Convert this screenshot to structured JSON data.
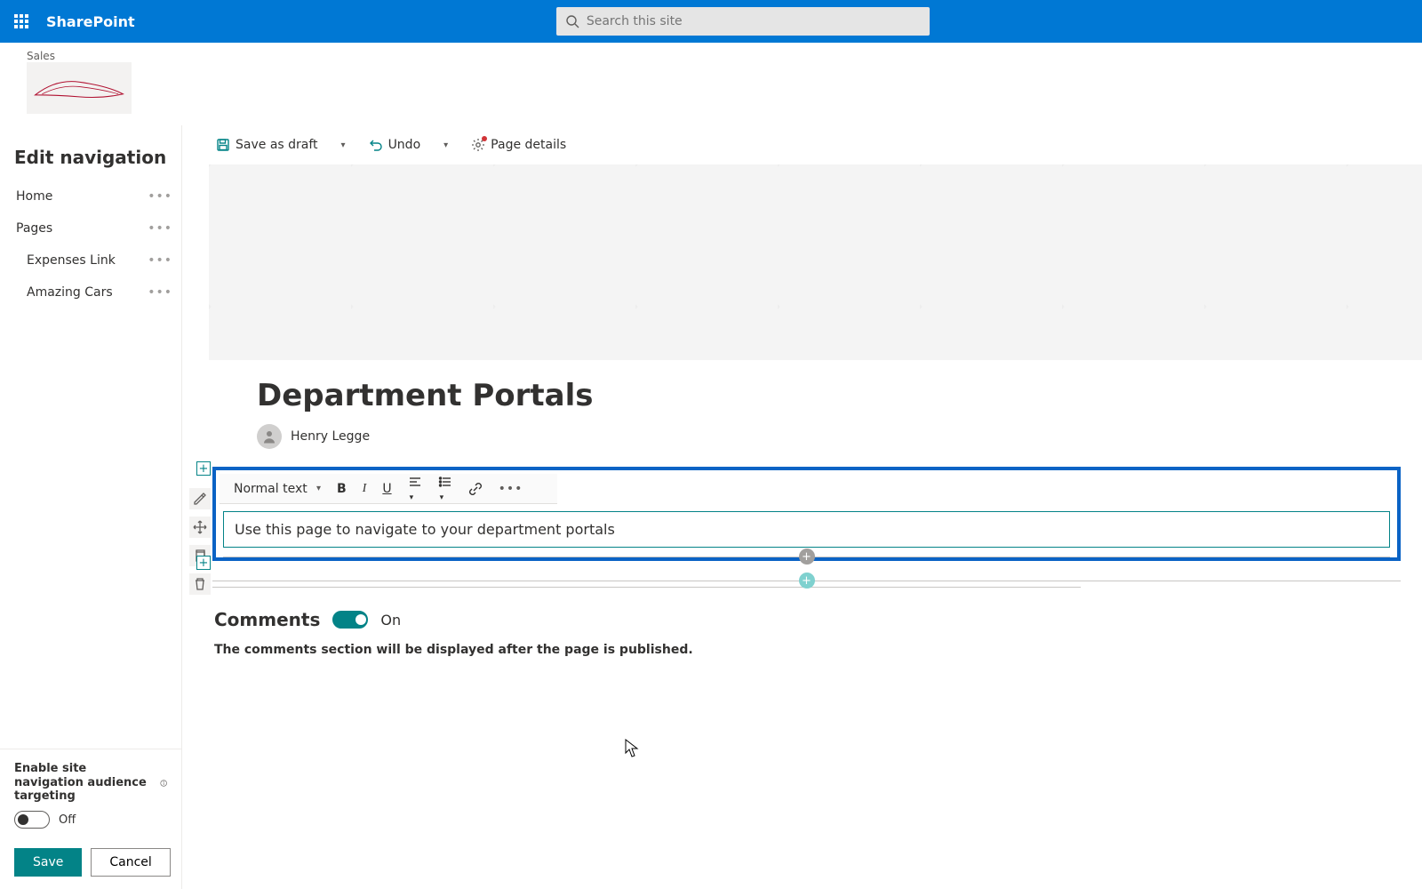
{
  "app": {
    "name": "SharePoint"
  },
  "search": {
    "placeholder": "Search this site"
  },
  "site": {
    "breadcrumb": "Sales"
  },
  "nav": {
    "title": "Edit navigation",
    "items": [
      {
        "label": "Home"
      },
      {
        "label": "Pages"
      },
      {
        "label": "Expenses Link"
      },
      {
        "label": "Amazing Cars"
      }
    ],
    "audienceTargeting": {
      "label": "Enable site navigation audience targeting",
      "state": "Off"
    },
    "saveLabel": "Save",
    "cancelLabel": "Cancel"
  },
  "commandBar": {
    "saveDraft": "Save as draft",
    "undo": "Undo",
    "pageDetails": "Page details"
  },
  "page": {
    "title": "Department Portals",
    "author": "Henry Legge"
  },
  "rte": {
    "styleName": "Normal text",
    "content": "Use this page to navigate to your department portals"
  },
  "comments": {
    "heading": "Comments",
    "toggleState": "On",
    "note": "The comments section will be displayed after the page is published."
  },
  "icons": {
    "waffle": "app-launcher-icon",
    "search": "search-icon",
    "save": "save-icon",
    "undo": "undo-icon",
    "gear": "gear-icon",
    "chevronDown": "chevron-down-icon",
    "bold": "B",
    "italic": "I",
    "underline": "U",
    "link": "link-icon",
    "more": "more-icon"
  }
}
